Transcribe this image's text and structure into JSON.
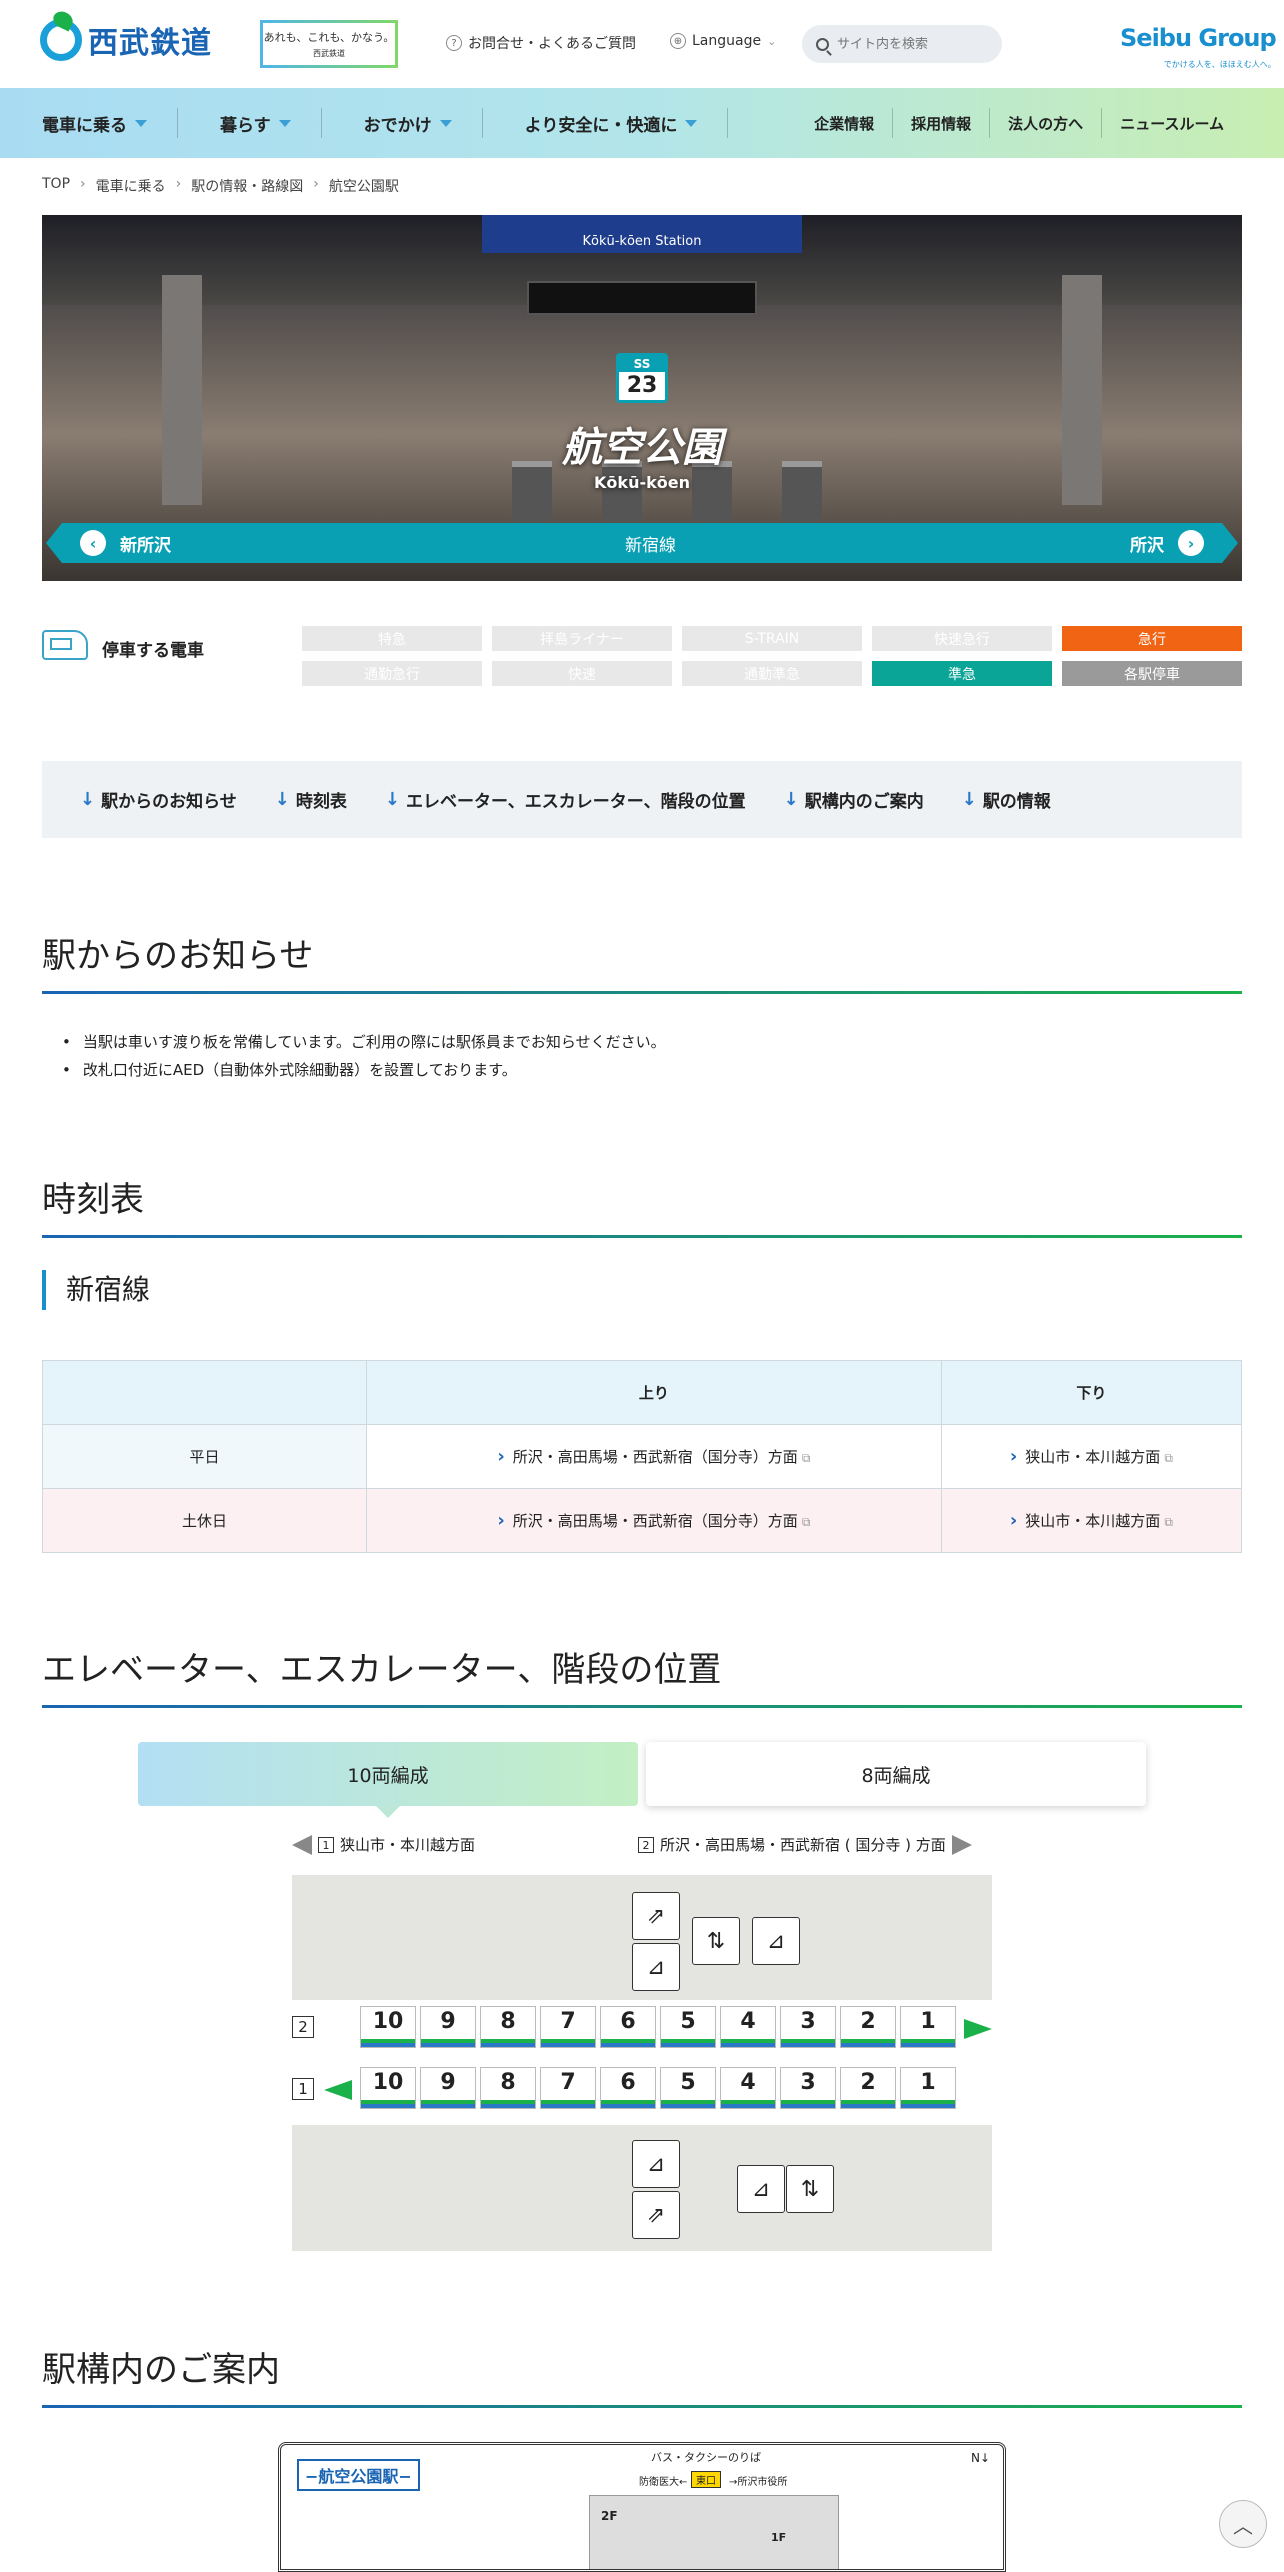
{
  "header": {
    "logo": "西武鉄道",
    "slogan": "あれも、これも、かなう。",
    "slogan_sub": "西武鉄道",
    "faq": "お問合せ・よくあるご質問",
    "language": "Language",
    "search_placeholder": "サイト内を検索",
    "group_name": "Seibu Group",
    "group_tagline": "でかける人を、ほほえむ人へ。"
  },
  "nav": {
    "left": [
      "電車に乗る",
      "暮らす",
      "おでかけ",
      "より安全に・快適に"
    ],
    "right": [
      "企業情報",
      "採用情報",
      "法人の方へ",
      "ニュースルーム"
    ]
  },
  "breadcrumb": [
    "TOP",
    "電車に乗る",
    "駅の情報・路線図",
    "航空公園駅"
  ],
  "hero": {
    "sign": "Kōkū-kōen Station",
    "line_code": "SS",
    "number": "23",
    "name_jp": "航空公園",
    "name_en": "Kōkū-kōen",
    "prev": "新所沢",
    "line": "新宿線",
    "next": "所沢"
  },
  "trains": {
    "label": "停車する電車",
    "types": [
      {
        "label": "特急",
        "active": false
      },
      {
        "label": "拝島ライナー",
        "active": false
      },
      {
        "label": "S-TRAIN",
        "active": false
      },
      {
        "label": "快速急行",
        "active": false
      },
      {
        "label": "急行",
        "active": true,
        "color": "#f06414"
      },
      {
        "label": "通勤急行",
        "active": false
      },
      {
        "label": "快速",
        "active": false
      },
      {
        "label": "通勤準急",
        "active": false
      },
      {
        "label": "準急",
        "active": true,
        "color": "#0aa596"
      },
      {
        "label": "各駅停車",
        "active": true,
        "color": "#9a9a9a"
      }
    ]
  },
  "inpage": [
    "駅からのお知らせ",
    "時刻表",
    "エレベーター、エスカレーター、階段の位置",
    "駅構内のご案内",
    "駅の情報"
  ],
  "notice": {
    "title": "駅からのお知らせ",
    "items": [
      "当駅は車いす渡り板を常備しています。ご利用の際には駅係員までお知らせください。",
      "改札口付近にAED（自動体外式除細動器）を設置しております。"
    ]
  },
  "timetable": {
    "title": "時刻表",
    "line": "新宿線",
    "headers": [
      "",
      "上り",
      "下り"
    ],
    "rows": [
      {
        "day": "平日",
        "up": "所沢・高田馬場・西武新宿（国分寺）方面",
        "down": "狭山市・本川越方面"
      },
      {
        "day": "土休日",
        "up": "所沢・高田馬場・西武新宿（国分寺）方面",
        "down": "狭山市・本川越方面"
      }
    ]
  },
  "elevator": {
    "title": "エレベーター、エスカレーター、階段の位置",
    "tabs": [
      "10両編成",
      "8両編成"
    ],
    "dir_left_no": "1",
    "dir_left": "狭山市・本川越方面",
    "dir_right_no": "2",
    "dir_right": "所沢・高田馬場・西武新宿 ( 国分寺 ) 方面",
    "track2": "2",
    "track1": "1",
    "cars": [
      "10",
      "9",
      "8",
      "7",
      "6",
      "5",
      "4",
      "3",
      "2",
      "1"
    ]
  },
  "guide": {
    "title": "駅構内のご案内",
    "map_title": "−航空公園駅−",
    "map_bus": "バス・タクシーのりば",
    "map_gate": "東口",
    "map_left": "防衛医大←",
    "map_right": "→所沢市役所",
    "map_floor": "2F",
    "map_floor2": "1F"
  },
  "totop": "︿"
}
